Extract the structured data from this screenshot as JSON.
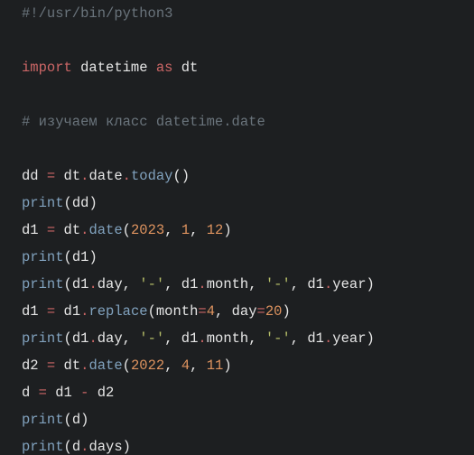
{
  "code": {
    "lines": [
      {
        "tokens": [
          {
            "cls": "tok-cmt",
            "text": "#!/usr/bin/python3"
          }
        ]
      },
      {
        "tokens": [
          {
            "cls": "tok-id",
            "text": ""
          }
        ]
      },
      {
        "tokens": [
          {
            "cls": "tok-kw",
            "text": "import"
          },
          {
            "cls": "tok-def",
            "text": " datetime "
          },
          {
            "cls": "tok-as",
            "text": "as"
          },
          {
            "cls": "tok-def",
            "text": " dt"
          }
        ]
      },
      {
        "tokens": [
          {
            "cls": "tok-id",
            "text": ""
          }
        ]
      },
      {
        "tokens": [
          {
            "cls": "tok-cmt",
            "text": "# изучаем класс datetime.date"
          }
        ]
      },
      {
        "tokens": [
          {
            "cls": "tok-id",
            "text": ""
          }
        ]
      },
      {
        "tokens": [
          {
            "cls": "tok-id",
            "text": "dd "
          },
          {
            "cls": "tok-op",
            "text": "="
          },
          {
            "cls": "tok-id",
            "text": " dt"
          },
          {
            "cls": "tok-op",
            "text": "."
          },
          {
            "cls": "tok-id",
            "text": "date"
          },
          {
            "cls": "tok-op",
            "text": "."
          },
          {
            "cls": "tok-fn",
            "text": "today"
          },
          {
            "cls": "tok-par",
            "text": "()"
          }
        ]
      },
      {
        "tokens": [
          {
            "cls": "tok-fn",
            "text": "print"
          },
          {
            "cls": "tok-par",
            "text": "("
          },
          {
            "cls": "tok-id",
            "text": "dd"
          },
          {
            "cls": "tok-par",
            "text": ")"
          }
        ]
      },
      {
        "tokens": [
          {
            "cls": "tok-id",
            "text": "d1 "
          },
          {
            "cls": "tok-op",
            "text": "="
          },
          {
            "cls": "tok-id",
            "text": " dt"
          },
          {
            "cls": "tok-op",
            "text": "."
          },
          {
            "cls": "tok-fn",
            "text": "date"
          },
          {
            "cls": "tok-par",
            "text": "("
          },
          {
            "cls": "tok-num",
            "text": "2023"
          },
          {
            "cls": "tok-par",
            "text": ","
          },
          {
            "cls": "tok-id",
            "text": " "
          },
          {
            "cls": "tok-num",
            "text": "1"
          },
          {
            "cls": "tok-par",
            "text": ","
          },
          {
            "cls": "tok-id",
            "text": " "
          },
          {
            "cls": "tok-num",
            "text": "12"
          },
          {
            "cls": "tok-par",
            "text": ")"
          }
        ]
      },
      {
        "tokens": [
          {
            "cls": "tok-fn",
            "text": "print"
          },
          {
            "cls": "tok-par",
            "text": "("
          },
          {
            "cls": "tok-id",
            "text": "d1"
          },
          {
            "cls": "tok-par",
            "text": ")"
          }
        ]
      },
      {
        "tokens": [
          {
            "cls": "tok-fn",
            "text": "print"
          },
          {
            "cls": "tok-par",
            "text": "("
          },
          {
            "cls": "tok-id",
            "text": "d1"
          },
          {
            "cls": "tok-op",
            "text": "."
          },
          {
            "cls": "tok-id",
            "text": "day"
          },
          {
            "cls": "tok-par",
            "text": ","
          },
          {
            "cls": "tok-id",
            "text": " "
          },
          {
            "cls": "tok-str",
            "text": "'-'"
          },
          {
            "cls": "tok-par",
            "text": ","
          },
          {
            "cls": "tok-id",
            "text": " d1"
          },
          {
            "cls": "tok-op",
            "text": "."
          },
          {
            "cls": "tok-id",
            "text": "month"
          },
          {
            "cls": "tok-par",
            "text": ","
          },
          {
            "cls": "tok-id",
            "text": " "
          },
          {
            "cls": "tok-str",
            "text": "'-'"
          },
          {
            "cls": "tok-par",
            "text": ","
          },
          {
            "cls": "tok-id",
            "text": " d1"
          },
          {
            "cls": "tok-op",
            "text": "."
          },
          {
            "cls": "tok-id",
            "text": "year"
          },
          {
            "cls": "tok-par",
            "text": ")"
          }
        ]
      },
      {
        "tokens": [
          {
            "cls": "tok-id",
            "text": "d1 "
          },
          {
            "cls": "tok-op",
            "text": "="
          },
          {
            "cls": "tok-id",
            "text": " d1"
          },
          {
            "cls": "tok-op",
            "text": "."
          },
          {
            "cls": "tok-fn",
            "text": "replace"
          },
          {
            "cls": "tok-par",
            "text": "("
          },
          {
            "cls": "tok-id",
            "text": "month"
          },
          {
            "cls": "tok-op",
            "text": "="
          },
          {
            "cls": "tok-num",
            "text": "4"
          },
          {
            "cls": "tok-par",
            "text": ","
          },
          {
            "cls": "tok-id",
            "text": " day"
          },
          {
            "cls": "tok-op",
            "text": "="
          },
          {
            "cls": "tok-num",
            "text": "20"
          },
          {
            "cls": "tok-par",
            "text": ")"
          }
        ]
      },
      {
        "tokens": [
          {
            "cls": "tok-fn",
            "text": "print"
          },
          {
            "cls": "tok-par",
            "text": "("
          },
          {
            "cls": "tok-id",
            "text": "d1"
          },
          {
            "cls": "tok-op",
            "text": "."
          },
          {
            "cls": "tok-id",
            "text": "day"
          },
          {
            "cls": "tok-par",
            "text": ","
          },
          {
            "cls": "tok-id",
            "text": " "
          },
          {
            "cls": "tok-str",
            "text": "'-'"
          },
          {
            "cls": "tok-par",
            "text": ","
          },
          {
            "cls": "tok-id",
            "text": " d1"
          },
          {
            "cls": "tok-op",
            "text": "."
          },
          {
            "cls": "tok-id",
            "text": "month"
          },
          {
            "cls": "tok-par",
            "text": ","
          },
          {
            "cls": "tok-id",
            "text": " "
          },
          {
            "cls": "tok-str",
            "text": "'-'"
          },
          {
            "cls": "tok-par",
            "text": ","
          },
          {
            "cls": "tok-id",
            "text": " d1"
          },
          {
            "cls": "tok-op",
            "text": "."
          },
          {
            "cls": "tok-id",
            "text": "year"
          },
          {
            "cls": "tok-par",
            "text": ")"
          }
        ]
      },
      {
        "tokens": [
          {
            "cls": "tok-id",
            "text": "d2 "
          },
          {
            "cls": "tok-op",
            "text": "="
          },
          {
            "cls": "tok-id",
            "text": " dt"
          },
          {
            "cls": "tok-op",
            "text": "."
          },
          {
            "cls": "tok-fn",
            "text": "date"
          },
          {
            "cls": "tok-par",
            "text": "("
          },
          {
            "cls": "tok-num",
            "text": "2022"
          },
          {
            "cls": "tok-par",
            "text": ","
          },
          {
            "cls": "tok-id",
            "text": " "
          },
          {
            "cls": "tok-num",
            "text": "4"
          },
          {
            "cls": "tok-par",
            "text": ","
          },
          {
            "cls": "tok-id",
            "text": " "
          },
          {
            "cls": "tok-num",
            "text": "11"
          },
          {
            "cls": "tok-par",
            "text": ")"
          }
        ]
      },
      {
        "tokens": [
          {
            "cls": "tok-id",
            "text": "d "
          },
          {
            "cls": "tok-op",
            "text": "="
          },
          {
            "cls": "tok-id",
            "text": " d1 "
          },
          {
            "cls": "tok-op",
            "text": "-"
          },
          {
            "cls": "tok-id",
            "text": " d2"
          }
        ]
      },
      {
        "tokens": [
          {
            "cls": "tok-fn",
            "text": "print"
          },
          {
            "cls": "tok-par",
            "text": "("
          },
          {
            "cls": "tok-id",
            "text": "d"
          },
          {
            "cls": "tok-par",
            "text": ")"
          }
        ]
      },
      {
        "tokens": [
          {
            "cls": "tok-fn",
            "text": "print"
          },
          {
            "cls": "tok-par",
            "text": "("
          },
          {
            "cls": "tok-id",
            "text": "d"
          },
          {
            "cls": "tok-op",
            "text": "."
          },
          {
            "cls": "tok-id",
            "text": "days"
          },
          {
            "cls": "tok-par",
            "text": ")"
          }
        ]
      }
    ]
  }
}
